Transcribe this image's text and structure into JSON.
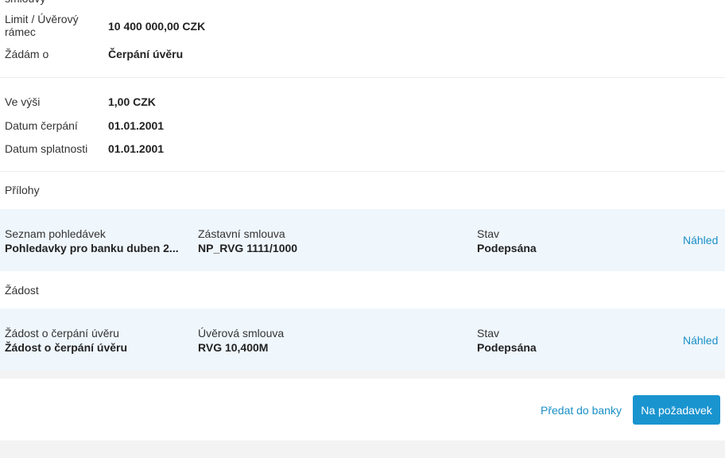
{
  "summary": {
    "cutoff_label": "smlouvy",
    "limit_label": "Limit / Úvěrový rámec",
    "limit_value": "10 400 000,00 CZK",
    "request_label": "Žádám o",
    "request_value": "Čerpání úvěru",
    "amount_label": "Ve výši",
    "amount_value": "1,00 CZK",
    "draw_date_label": "Datum čerpání",
    "draw_date_value": "01.01.2001",
    "due_date_label": "Datum splatnosti",
    "due_date_value": "01.01.2001"
  },
  "attachments": {
    "title": "Přílohy",
    "row": {
      "col1_label": "Seznam pohledávek",
      "col1_value": "Pohledavky pro banku duben 2...",
      "col2_label": "Zástavní smlouva",
      "col2_value": "NP_RVG 1111/1000",
      "status_label": "Stav",
      "status_value": "Podepsána",
      "action": "Náhled"
    }
  },
  "application": {
    "title": "Žádost",
    "row": {
      "col1_label": "Žádost o čerpání úvěru",
      "col1_value": "Žádost o čerpání úvěru",
      "col2_label": "Úvěrová smlouva",
      "col2_value": "RVG 10,400M",
      "status_label": "Stav",
      "status_value": "Podepsána",
      "action": "Náhled"
    }
  },
  "footer": {
    "handover_label": "Předat do banky",
    "primary_label": "Na požadavek"
  },
  "colors": {
    "accent": "#1a94cf",
    "link": "#1a8fc6",
    "row_background": "#eff6fc"
  }
}
